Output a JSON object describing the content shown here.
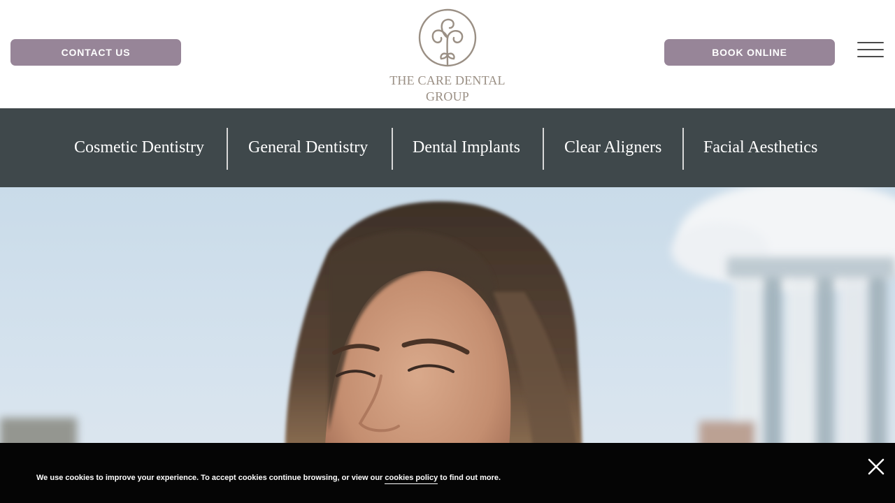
{
  "header": {
    "contact_label": "CONTACT US",
    "book_label": "BOOK ONLINE",
    "logo_line1": "THE CARE DENTAL",
    "logo_line2": "GROUP",
    "menu_icon": "hamburger-menu-icon"
  },
  "nav": {
    "items": [
      {
        "label": "Cosmetic Dentistry"
      },
      {
        "label": "General Dentistry"
      },
      {
        "label": "Dental Implants"
      },
      {
        "label": "Clear Aligners"
      },
      {
        "label": "Facial Aesthetics"
      }
    ]
  },
  "hero": {
    "image": "smiling-woman-hero-photo"
  },
  "cookie": {
    "text_before": "We use cookies to improve your experience. To accept cookies continue browsing, or view our ",
    "link_label": "cookies policy",
    "text_after": " to find out more.",
    "close_icon": "close-icon"
  },
  "colors": {
    "button_bg": "#978598",
    "logo_color": "#9a8f84",
    "nav_bg": "#3f484b",
    "cookie_bg": "#050505"
  }
}
